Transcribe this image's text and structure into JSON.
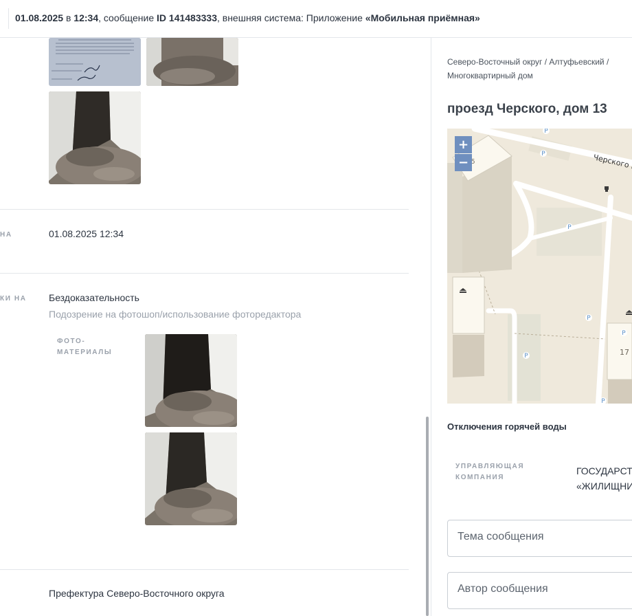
{
  "header": {
    "date": "01.08.2025",
    "in_word": " в ",
    "time": "12:34",
    "message_prefix": ", сообщение ",
    "message_id": "ID 141483333",
    "system_prefix": ", внешняя система: Приложение ",
    "system_name": "«Мобильная приёмная»"
  },
  "sections": {
    "date_row": {
      "label_cut": "НА",
      "value": "01.08.2025 12:34"
    },
    "rejection": {
      "label_cut": "КИ НА",
      "reason": "Бездоказательность",
      "detail": "Подозрение на фотошоп/использование фоторедактора",
      "photos_label": "ФОТО-\nМАТЕРИАЛЫ"
    },
    "organization": {
      "value": "Префектура Северо-Восточного округа"
    }
  },
  "building": {
    "breadcrumb": "Северо-Восточный округ / Алтуфьевский / Многоквартирный дом",
    "address": "проезд Черского, дом 13",
    "map": {
      "zoom_in": "+",
      "zoom_out": "−",
      "street_label": "Черского п",
      "house_15": "15",
      "house_17": "17",
      "parking_symbol": "P",
      "colors": {
        "background": "#efe9dc",
        "road": "#ffffff",
        "building": "#fbf8ef",
        "zoom": "#6f8fbf"
      }
    },
    "hot_water_title": "Отключения горячей воды",
    "management_label": "УПРАВЛЯЮЩАЯ\nКОМПАНИЯ",
    "management_value": "ГОСУДАРСТВ\n«ЖИЛИЩНИ"
  },
  "form": {
    "subject_placeholder": "Тема сообщения",
    "author_placeholder": "Автор сообщения"
  }
}
